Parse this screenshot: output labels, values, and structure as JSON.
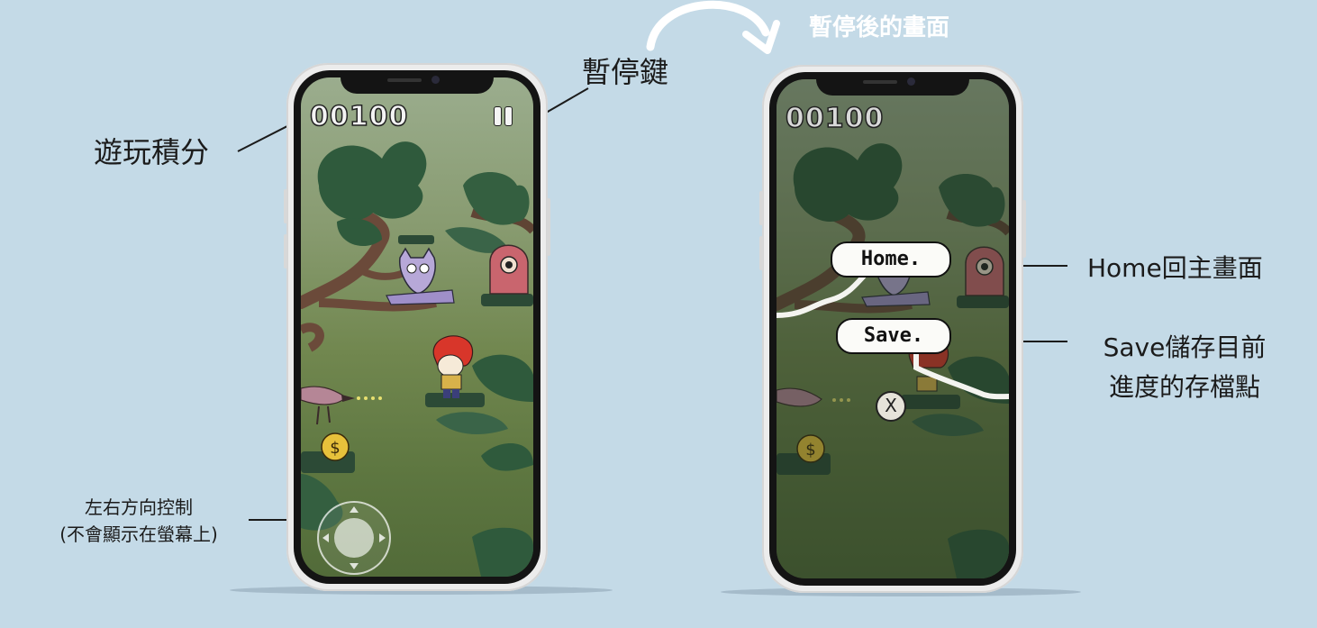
{
  "annotations": {
    "score_label": "遊玩積分",
    "pause_key_label": "暫停鍵",
    "direction_label_line1": "左右方向控制",
    "direction_label_line2": "(不會顯示在螢幕上)",
    "after_pause_label": "暫停後的畫面",
    "home_label": "Home回主畫面",
    "save_label_line1": "Save儲存目前",
    "save_label_line2": "進度的存檔點"
  },
  "game": {
    "score": "00100",
    "home_button": "Home.",
    "save_button": "Save.",
    "close_symbol": "X",
    "coin_symbol": "$"
  },
  "colors": {
    "background": "#c4dae7",
    "foliage_dark": "#2f5a3c",
    "branch": "#6b4a3a",
    "enemy_pink": "#c9656e",
    "enemy_purple": "#9f8fc9",
    "hero_hair": "#d8362a",
    "coin": "#e7c13b"
  },
  "icons": [
    "pause-icon",
    "curved-arrow-icon",
    "dpad-icon",
    "close-icon",
    "coin-icon"
  ]
}
